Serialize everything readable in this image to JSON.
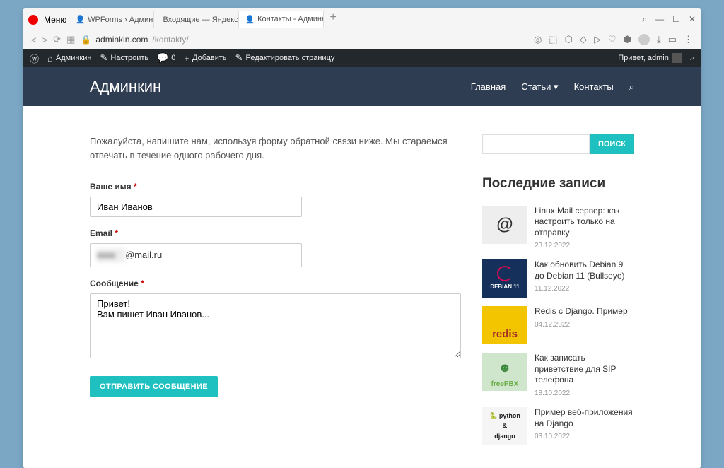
{
  "browser": {
    "menu": "Меню",
    "tabs": [
      {
        "label": "WPForms › Админкин",
        "icon": "👤"
      },
      {
        "label": "Входящие — Яндекс Поч",
        "icon_color": "#ffcc00"
      },
      {
        "label": "Контакты - Админкин",
        "icon": "👤",
        "active": true
      }
    ],
    "url_host": "adminkin.com",
    "url_path": "/kontakty/"
  },
  "wpbar": {
    "site": "Админкин",
    "customize": "Настроить",
    "comments": "0",
    "add": "Добавить",
    "edit": "Редактировать страницу",
    "greeting": "Привет, admin"
  },
  "header": {
    "title": "Админкин",
    "nav": {
      "home": "Главная",
      "articles": "Статьи",
      "contacts": "Контакты"
    }
  },
  "form": {
    "intro": "Пожалуйста, напишите нам, используя форму обратной связи ниже. Мы стараемся отвечать в течение одного рабочего дня.",
    "name_label": "Ваше имя",
    "name_value": "Иван Иванов",
    "email_label": "Email",
    "email_suffix": "@mail.ru",
    "msg_label": "Сообщение",
    "msg_value": "Привет!\nВам пишет Иван Иванов...",
    "submit": "ОТПРАВИТЬ СООБЩЕНИЕ"
  },
  "sidebar": {
    "search_btn": "ПОИСК",
    "recent_heading": "Последние записи",
    "posts": [
      {
        "title": "Linux Mail сервер: как настроить только на отправку",
        "date": "23.12.2022"
      },
      {
        "title": "Как обновить Debian 9 до Debian 11 (Bullseye)",
        "date": "11.12.2022"
      },
      {
        "title": "Redis с Django. Пример",
        "date": "04.12.2022"
      },
      {
        "title": "Как записать приветствие для SIP телефона",
        "date": "18.10.2022"
      },
      {
        "title": "Пример веб-приложения на Django",
        "date": "03.10.2022"
      }
    ]
  }
}
